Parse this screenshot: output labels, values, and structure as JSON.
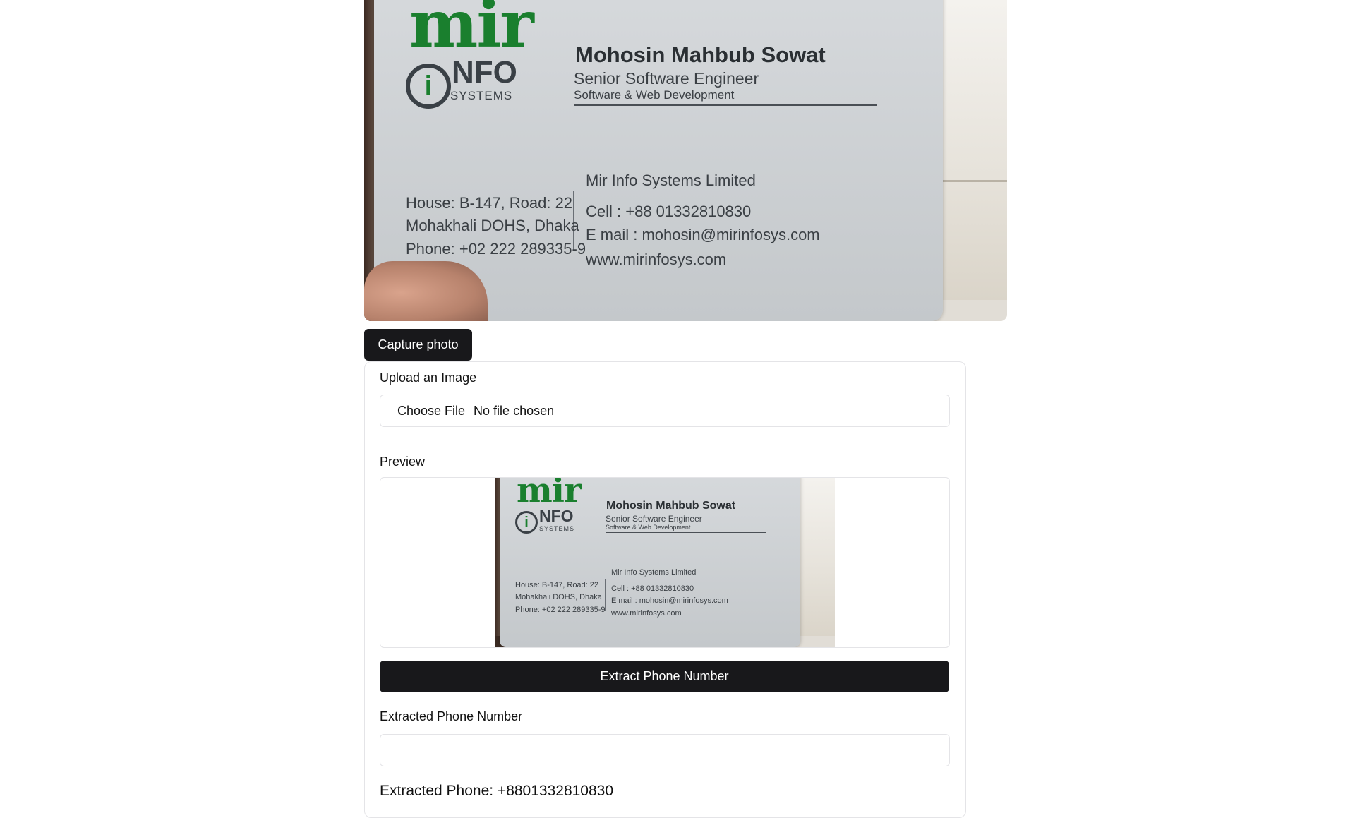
{
  "card": {
    "logo_mir": "mir",
    "logo_i": "i",
    "logo_info": "NFO",
    "logo_systems": "SYSTEMS",
    "name": "Mohosin Mahbub Sowat",
    "title": "Senior Software Engineer",
    "department": "Software & Web Development",
    "address_line1": "House: B-147, Road: 22",
    "address_line2": "Mohakhali DOHS, Dhaka",
    "address_phone": "Phone: +02 222 289335-9",
    "company": "Mir Info Systems Limited",
    "cell": "Cell    : +88 01332810830",
    "email": "E mail : mohosin@mirinfosys.com",
    "website": "www.mirinfosys.com"
  },
  "camera": {
    "capture_label": "Capture photo"
  },
  "upload": {
    "label": "Upload an Image",
    "choose_file_label": "Choose File",
    "file_status": "No file chosen"
  },
  "preview": {
    "label": "Preview"
  },
  "extract": {
    "button_label": "Extract Phone Number",
    "field_label": "Extracted Phone Number",
    "field_value": "",
    "result_text": "Extracted Phone: +8801332810830"
  }
}
